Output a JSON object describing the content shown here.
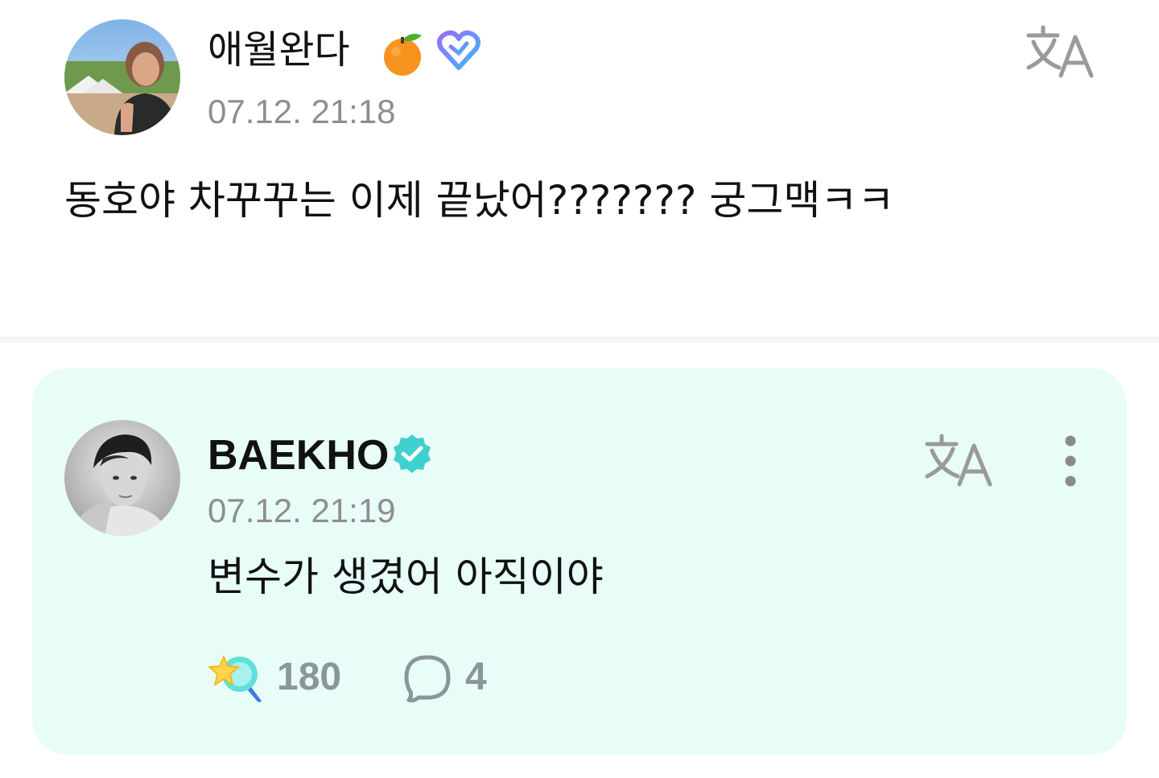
{
  "post": {
    "author": {
      "name": "애월완다",
      "avatar_icon": "user-photo-avatar",
      "emoji_icon": "tangerine-emoji-icon",
      "badge_icon": "fan-heart-badge-icon"
    },
    "timestamp": "07.12. 21:18",
    "body": "동호야 차꾸꾸는 이제 끝났어??????? 궁그맥ㅋㅋ",
    "translate_icon": "translate-icon"
  },
  "reply": {
    "author": {
      "name": "BAEKHO",
      "avatar_icon": "artist-photo-avatar",
      "verified_icon": "verified-check-icon"
    },
    "timestamp": "07.12. 21:19",
    "body": "변수가 생겼어 아직이야",
    "translate_icon": "translate-icon",
    "more_icon": "more-vertical-icon",
    "reactions": {
      "like_icon": "star-magnifier-like-icon",
      "like_count": "180",
      "comment_icon": "speech-bubble-icon",
      "comment_count": "4"
    }
  },
  "colors": {
    "reply_background": "#e8fcf8",
    "verified_teal": "#3fd0cf",
    "text_primary": "#111111",
    "text_secondary": "#8e8e8e",
    "divider": "#f3f4f4"
  }
}
